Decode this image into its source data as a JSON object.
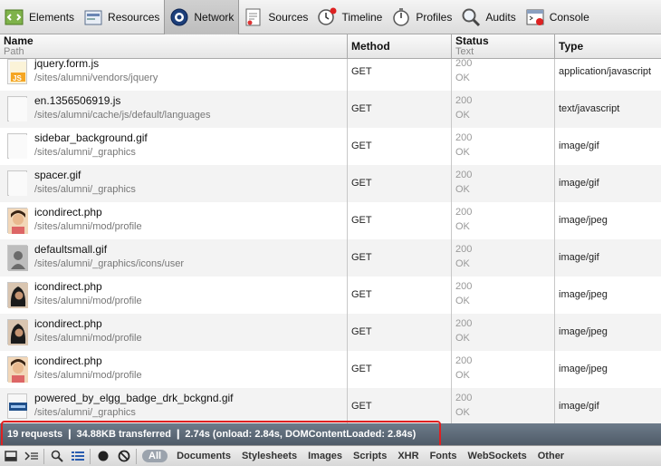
{
  "toolbar": {
    "items": [
      {
        "label": "Elements",
        "icon": "elements-icon"
      },
      {
        "label": "Resources",
        "icon": "resources-icon"
      },
      {
        "label": "Network",
        "icon": "network-icon",
        "selected": true
      },
      {
        "label": "Sources",
        "icon": "sources-icon"
      },
      {
        "label": "Timeline",
        "icon": "timeline-icon"
      },
      {
        "label": "Profiles",
        "icon": "profiles-icon"
      },
      {
        "label": "Audits",
        "icon": "audits-icon"
      },
      {
        "label": "Console",
        "icon": "console-icon"
      }
    ]
  },
  "grid": {
    "headers": {
      "name": "Name",
      "name_sub": "Path",
      "method": "Method",
      "status": "Status",
      "status_sub": "Text",
      "type": "Type"
    },
    "rows": [
      {
        "name": "jquery.form.js",
        "path": "/sites/alumni/vendors/jquery",
        "method": "GET",
        "status": "200",
        "status_text": "OK",
        "type": "application/javascript",
        "thumb": "js"
      },
      {
        "name": "en.1356506919.js",
        "path": "/sites/alumni/cache/js/default/languages",
        "method": "GET",
        "status": "200",
        "status_text": "OK",
        "type": "text/javascript",
        "thumb": "blank"
      },
      {
        "name": "sidebar_background.gif",
        "path": "/sites/alumni/_graphics",
        "method": "GET",
        "status": "200",
        "status_text": "OK",
        "type": "image/gif",
        "thumb": "blank"
      },
      {
        "name": "spacer.gif",
        "path": "/sites/alumni/_graphics",
        "method": "GET",
        "status": "200",
        "status_text": "OK",
        "type": "image/gif",
        "thumb": "blank"
      },
      {
        "name": "icondirect.php",
        "path": "/sites/alumni/mod/profile",
        "method": "GET",
        "status": "200",
        "status_text": "OK",
        "type": "image/jpeg",
        "thumb": "face-light"
      },
      {
        "name": "defaultsmall.gif",
        "path": "/sites/alumni/_graphics/icons/user",
        "method": "GET",
        "status": "200",
        "status_text": "OK",
        "type": "image/gif",
        "thumb": "user"
      },
      {
        "name": "icondirect.php",
        "path": "/sites/alumni/mod/profile",
        "method": "GET",
        "status": "200",
        "status_text": "OK",
        "type": "image/jpeg",
        "thumb": "face-dark"
      },
      {
        "name": "icondirect.php",
        "path": "/sites/alumni/mod/profile",
        "method": "GET",
        "status": "200",
        "status_text": "OK",
        "type": "image/jpeg",
        "thumb": "face-dark"
      },
      {
        "name": "icondirect.php",
        "path": "/sites/alumni/mod/profile",
        "method": "GET",
        "status": "200",
        "status_text": "OK",
        "type": "image/jpeg",
        "thumb": "face-light"
      },
      {
        "name": "powered_by_elgg_badge_drk_bckgnd.gif",
        "path": "/sites/alumni/_graphics",
        "method": "GET",
        "status": "200",
        "status_text": "OK",
        "type": "image/gif",
        "thumb": "badge"
      }
    ]
  },
  "summary": {
    "text": "19 requests  ❙  34.88KB transferred  ❙  2.74s (onload: 2.84s, DOMContentLoaded: 2.84s)"
  },
  "bottom_bar": {
    "filters": [
      "All",
      "Documents",
      "Stylesheets",
      "Images",
      "Scripts",
      "XHR",
      "Fonts",
      "WebSockets",
      "Other"
    ]
  }
}
